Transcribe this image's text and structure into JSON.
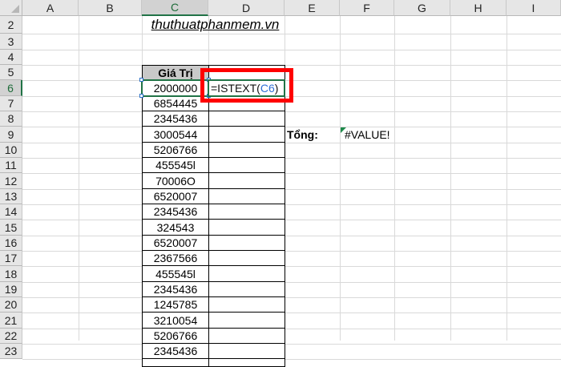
{
  "columns": [
    "A",
    "B",
    "C",
    "D",
    "E",
    "F",
    "G",
    "H",
    "I"
  ],
  "rows": [
    "2",
    "3",
    "4",
    "5",
    "6",
    "7",
    "8",
    "9",
    "10",
    "11",
    "12",
    "13",
    "14",
    "15",
    "16",
    "17",
    "18",
    "19",
    "20",
    "21",
    "22",
    "23"
  ],
  "active_column": "C",
  "active_row": "6",
  "sheet": {
    "title": "thuthuatphanmem.vn",
    "header_label": "Giá Trị",
    "values": [
      "2000000",
      "6854445",
      "2345436",
      "3000544",
      "5206766",
      "455545l",
      "70006O",
      "6520007",
      "2345436",
      "324543",
      "6520007",
      "2367566",
      "455545l",
      "2345436",
      "1245785",
      "3210054",
      "5206766",
      "2345436"
    ],
    "formula_prefix": "=ISTEXT(",
    "formula_ref": "C6",
    "formula_suffix": ")",
    "total_label": "Tổng:",
    "total_value": "#VALUE!"
  },
  "colors": {
    "accent_selection": "#217346",
    "highlight_box": "#ff0000",
    "formula_ref": "#2f6fd6",
    "header_fill": "#c9c9c9"
  }
}
